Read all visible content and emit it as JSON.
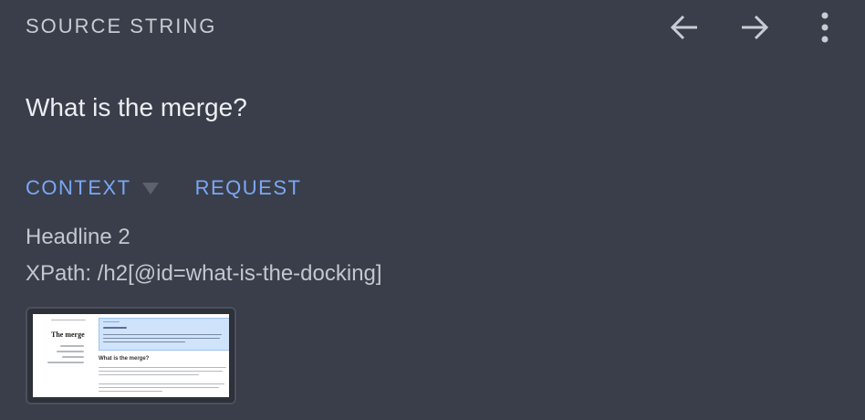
{
  "header": {
    "title": "SOURCE STRING",
    "back_icon": "arrow-left-icon",
    "forward_icon": "arrow-right-icon",
    "menu_icon": "more-vertical-icon"
  },
  "source": {
    "text": "What is the merge?"
  },
  "tabs": [
    {
      "label": "CONTEXT",
      "icon": "caret-down-icon"
    },
    {
      "label": "REQUEST"
    }
  ],
  "context": {
    "element_type": "Headline 2",
    "xpath": "XPath: /h2[@id=what-is-the-docking]"
  },
  "screenshot_thumbnail": {
    "page_title": "The merge",
    "section_heading": "What is the merge?"
  },
  "colors": {
    "background": "#393e4a",
    "accent": "#7aa8f5",
    "muted_text": "#c3c7ce"
  }
}
